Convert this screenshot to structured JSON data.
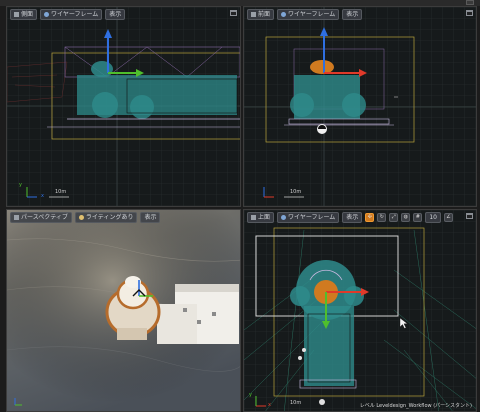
{
  "viewports": {
    "side": {
      "type_label": "側面",
      "view_mode": "ワイヤーフレーム",
      "show_label": "表示",
      "scale": "10m",
      "axis_x": "x",
      "axis_y": "y"
    },
    "front": {
      "type_label": "前面",
      "view_mode": "ワイヤーフレーム",
      "show_label": "表示",
      "scale": "10m"
    },
    "perspective": {
      "type_label": "パースペクティブ",
      "view_mode": "ライティングあり",
      "show_label": "表示"
    },
    "top": {
      "type_label": "上面",
      "view_mode": "ワイヤーフレーム",
      "show_label": "表示",
      "grid_value": "10",
      "scale": "10m",
      "axis_x": "x",
      "axis_y": "y"
    }
  },
  "status": {
    "level_label": "レベル",
    "level_name": "Leveldesign_Workflow (パーシスタント)"
  },
  "colors": {
    "accent_orange": "#d07a20",
    "axis_x": "#e03a2a",
    "axis_y": "#4fbf2c",
    "axis_z": "#2f6fe0",
    "viewport_bg": "#171a1b"
  }
}
